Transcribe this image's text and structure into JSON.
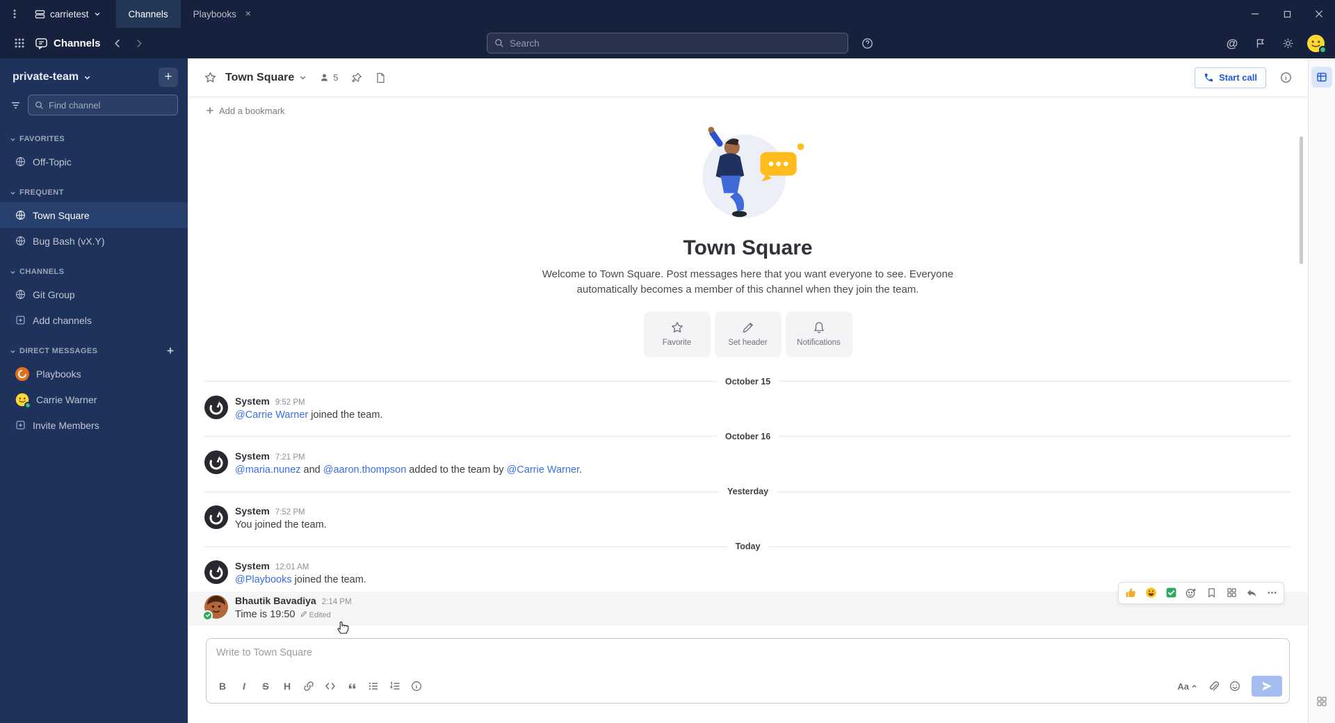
{
  "icons": {
    "plus": "+",
    "at_sign": "@",
    "tab_close": "×"
  },
  "titlebar": {
    "server_name": "carrietest",
    "tabs": [
      {
        "label": "Channels",
        "active": true
      },
      {
        "label": "Playbooks",
        "active": false,
        "closable": true
      }
    ]
  },
  "global_header": {
    "product_name": "Channels",
    "search_placeholder": "Search"
  },
  "sidebar": {
    "team_name": "private-team",
    "find_channel_placeholder": "Find channel",
    "sections": [
      {
        "label": "FAVORITES",
        "items": [
          {
            "label": "Off-Topic",
            "icon": "globe-icon"
          }
        ]
      },
      {
        "label": "FREQUENT",
        "items": [
          {
            "label": "Town Square",
            "icon": "globe-icon",
            "active": true
          },
          {
            "label": "Bug Bash (vX.Y)",
            "icon": "globe-icon"
          }
        ]
      },
      {
        "label": "CHANNELS",
        "items": [
          {
            "label": "Git Group",
            "icon": "globe-icon"
          },
          {
            "label": "Add channels",
            "icon": "plus-box-icon"
          }
        ]
      },
      {
        "label": "DIRECT MESSAGES",
        "items": [
          {
            "label": "Playbooks",
            "icon": "playbooks-avatar"
          },
          {
            "label": "Carrie Warner",
            "icon": "smiley-avatar"
          },
          {
            "label": "Invite Members",
            "icon": "plus-box-icon"
          }
        ]
      }
    ]
  },
  "channel_header": {
    "title": "Town Square",
    "member_count": "5",
    "start_call_label": "Start call"
  },
  "bookmark_bar": {
    "add_label": "Add a bookmark"
  },
  "intro": {
    "title": "Town Square",
    "description": "Welcome to Town Square. Post messages here that you want everyone to see. Everyone automatically becomes a member of this channel when they join the team.",
    "actions": [
      {
        "label": "Favorite",
        "icon": "star-icon"
      },
      {
        "label": "Set header",
        "icon": "pencil-icon"
      },
      {
        "label": "Notifications",
        "icon": "bell-icon"
      }
    ]
  },
  "feed": {
    "items": [
      {
        "type": "divider",
        "label": "October 15"
      },
      {
        "type": "system",
        "sender": "System",
        "time": "9:52 PM",
        "parts": [
          {
            "kind": "link",
            "text": "@Carrie Warner"
          },
          {
            "kind": "text",
            "text": " joined the team."
          }
        ]
      },
      {
        "type": "divider",
        "label": "October 16"
      },
      {
        "type": "system",
        "sender": "System",
        "time": "7:21 PM",
        "parts": [
          {
            "kind": "link",
            "text": "@maria.nunez"
          },
          {
            "kind": "text",
            "text": " and "
          },
          {
            "kind": "link",
            "text": "@aaron.thompson"
          },
          {
            "kind": "text",
            "text": " added to the team by "
          },
          {
            "kind": "link",
            "text": "@Carrie Warner"
          },
          {
            "kind": "text",
            "text": "."
          }
        ]
      },
      {
        "type": "divider",
        "label": "Yesterday"
      },
      {
        "type": "system",
        "sender": "System",
        "time": "7:52 PM",
        "parts": [
          {
            "kind": "text",
            "text": "You joined the team."
          }
        ]
      },
      {
        "type": "divider",
        "label": "Today"
      },
      {
        "type": "system",
        "sender": "System",
        "time": "12:01 AM",
        "parts": [
          {
            "kind": "link",
            "text": "@Playbooks"
          },
          {
            "kind": "text",
            "text": " joined the team."
          }
        ]
      },
      {
        "type": "post",
        "sender": "Bhautik Bavadiya",
        "time": "2:14 PM",
        "text": "Time is 19:50",
        "edited_label": "Edited"
      }
    ]
  },
  "hover_toolbar": {
    "quick_reactions": [
      "thumbs-up",
      "grinning-face",
      "white-check-mark"
    ],
    "buttons": [
      "add-reaction",
      "save-message",
      "message-apps",
      "reply",
      "more-actions"
    ]
  },
  "composer": {
    "placeholder": "Write to Town Square",
    "format_buttons": [
      "B",
      "I",
      "S",
      "H"
    ],
    "text_style_label": "Aa"
  }
}
